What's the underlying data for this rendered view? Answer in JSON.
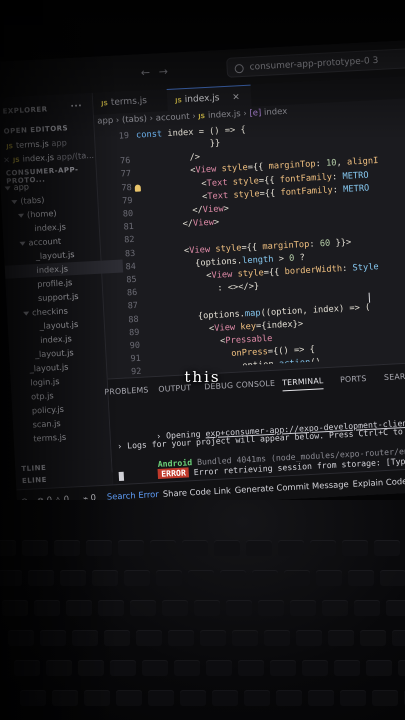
{
  "window": {
    "command_center": "consumer-app-prototype-0 3"
  },
  "sidebar": {
    "explorer_label": "EXPLORER",
    "more_label": "···",
    "open_editors_label": "OPEN EDITORS",
    "open_editors": [
      {
        "name": "terms.js",
        "dim": "app"
      },
      {
        "name": "index.js",
        "dim": "app/(ta..."
      }
    ],
    "project_label": "CONSUMER-APP-PROTO...",
    "tree": [
      {
        "label": "app",
        "kind": "folder",
        "indent": 0
      },
      {
        "label": "(tabs)",
        "kind": "folder",
        "indent": 1
      },
      {
        "label": "(home)",
        "kind": "folder-open",
        "indent": 2
      },
      {
        "label": "index.js",
        "kind": "file",
        "indent": 3
      },
      {
        "label": "account",
        "kind": "folder",
        "indent": 2
      },
      {
        "label": "_layout.js",
        "kind": "file",
        "indent": 3
      },
      {
        "label": "index.js",
        "kind": "file",
        "indent": 3,
        "selected": true
      },
      {
        "label": "profile.js",
        "kind": "file",
        "indent": 3
      },
      {
        "label": "support.js",
        "kind": "file",
        "indent": 3
      },
      {
        "label": "checkins",
        "kind": "folder",
        "indent": 2
      },
      {
        "label": "_layout.js",
        "kind": "file",
        "indent": 3
      },
      {
        "label": "index.js",
        "kind": "file",
        "indent": 3
      },
      {
        "label": "_layout.js",
        "kind": "file",
        "indent": 2
      },
      {
        "label": "_layout.js",
        "kind": "file",
        "indent": 1
      },
      {
        "label": "login.js",
        "kind": "file",
        "indent": 1
      },
      {
        "label": "otp.js",
        "kind": "file",
        "indent": 1
      },
      {
        "label": "policy.js",
        "kind": "file",
        "indent": 1
      },
      {
        "label": "scan.js",
        "kind": "file",
        "indent": 1
      },
      {
        "label": "terms.js",
        "kind": "file",
        "indent": 1
      }
    ],
    "outline_label": "TLINE",
    "timeline_label": "ELINE"
  },
  "editor": {
    "tabs": [
      {
        "label": "terms.js",
        "active": false
      },
      {
        "label": "index.js",
        "active": true
      }
    ],
    "tab_close": "×",
    "breadcrumb": [
      "app",
      "(tabs)",
      "account",
      "index.js",
      "index"
    ],
    "line_numbers": [
      19,
      76,
      77,
      78,
      79,
      80,
      81,
      82,
      83,
      84,
      85,
      86,
      87,
      88,
      89,
      90,
      91,
      92
    ],
    "code_lines": [
      "const index = () => {",
      "              }}",
      "          />",
      "          <View style={{ marginTop: 10, alignI",
      "            <Text style={{ fontFamily: METRO",
      "            <Text style={{ fontFamily: METRO",
      "          </View>",
      "        </View>",
      "",
      "        <View style={{ marginTop: 60 }}>",
      "          {options.length > 0 ?",
      "            <View style={{ borderWidth: Style",
      "              : <></>}",
      "",
      "          {options.map((option, index) => (",
      "            <View key={index}>",
      "              <Pressable",
      "                onPress={() => {",
      "                  option.action()",
      "                }}"
    ]
  },
  "panel": {
    "tabs": [
      "PROBLEMS",
      "OUTPUT",
      "DEBUG CONSOLE",
      "TERMINAL",
      "PORTS",
      "SEARCH"
    ],
    "active_tab": "TERMINAL",
    "terminal": {
      "line1_prefix": "› Opening ",
      "line1_url": "exp+consumer-app://expo-development-client/?url=http%3A%2",
      "line2": "› Logs for your project will appear below. Press Ctrl+C to exit.",
      "line3_platform": "Android",
      "line3_bundled": " Bundled 4041ms (node_modules/expo-router/entry.js)",
      "line4_badge": "ERROR",
      "line4_text": " Error retrieving session from storage: [TypeError: Cannot"
    }
  },
  "statusbar": {
    "errors": "0",
    "warnings": "0",
    "ports": "0",
    "items": [
      "Search Error",
      "Share Code Link",
      "Generate Commit Message",
      "Explain Code",
      "Co"
    ]
  },
  "caption": "this"
}
